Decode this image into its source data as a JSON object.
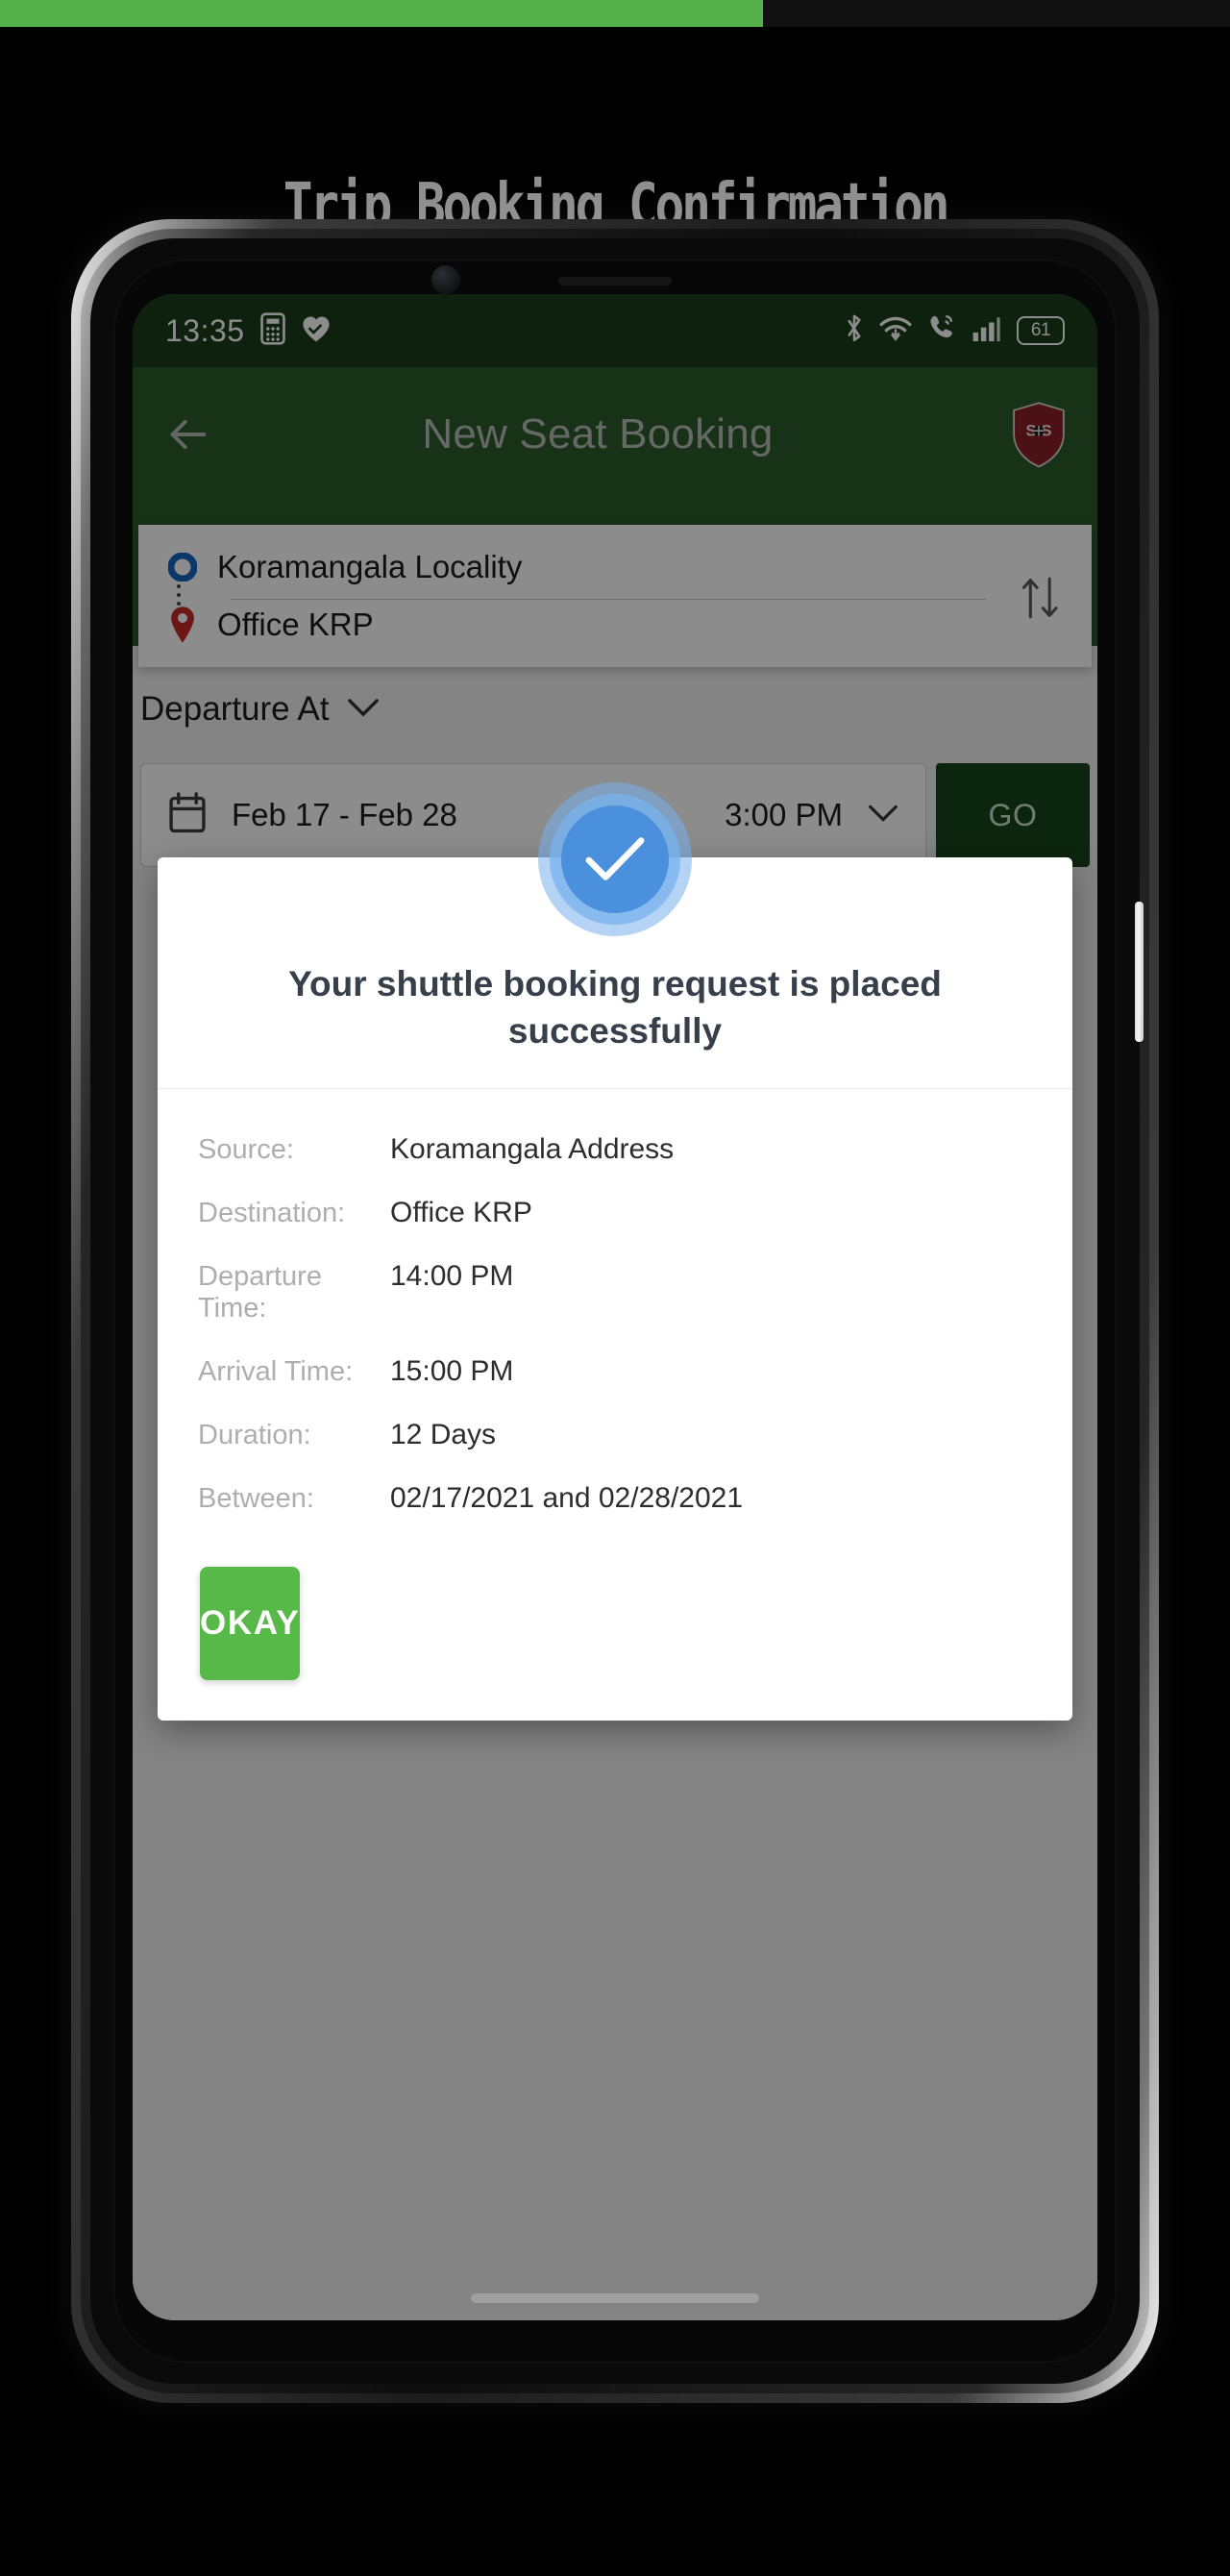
{
  "page": {
    "heading": "Trip Booking Confirmation",
    "progress_percent": 62,
    "accent_green": "#54b14c",
    "background": "#000000"
  },
  "phone": {
    "status_bar": {
      "time": "13:35",
      "left_icons": [
        "calculator-icon",
        "heart-icon"
      ],
      "right_icons": [
        "bluetooth-icon",
        "wifi-icon",
        "call-icon",
        "signal-icon"
      ],
      "battery_level": "61",
      "background": "#1b3d1b"
    },
    "app_bar": {
      "back_label": "Back",
      "title": "New Seat Booking",
      "sos_label": "SOS",
      "background": "#2b5b2b"
    },
    "booking_form": {
      "source_value": "Koramangala Locality",
      "destination_value": "Office KRP",
      "swap_label": "Swap source and destination",
      "departure_section_label": "Departure At",
      "date_range_value": "Feb 17 - Feb 28",
      "time_value": "3:00 PM",
      "go_label": "GO"
    }
  },
  "dialog": {
    "icon": "success-check-icon",
    "title": "Your shuttle booking request is placed successfully",
    "details": [
      {
        "label": "Source:",
        "value": "Koramangala Address"
      },
      {
        "label": "Destination:",
        "value": "Office KRP"
      },
      {
        "label": "Departure Time:",
        "value": "14:00 PM"
      },
      {
        "label": "Arrival Time:",
        "value": "15:00 PM"
      },
      {
        "label": "Duration:",
        "value": "12 Days"
      },
      {
        "label": "Between:",
        "value": "02/17/2021 and 02/28/2021"
      }
    ],
    "confirm_label": "OKAY",
    "confirm_color": "#56b948"
  }
}
